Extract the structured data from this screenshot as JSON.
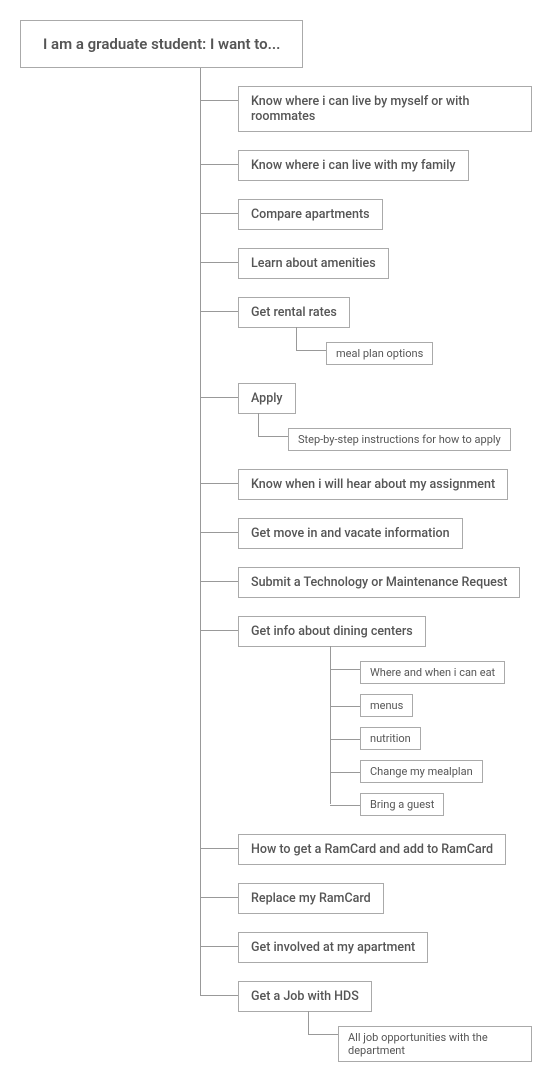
{
  "root": "I am a graduate student: I want to...",
  "nodes": [
    {
      "label": "Know where i can live by myself or with roommates",
      "children": []
    },
    {
      "label": "Know where i can live with my family",
      "children": []
    },
    {
      "label": "Compare apartments",
      "children": []
    },
    {
      "label": "Learn about amenities",
      "children": []
    },
    {
      "label": "Get rental rates",
      "children": [
        "meal plan options"
      ]
    },
    {
      "label": "Apply",
      "children": [
        "Step-by-step instructions for how to apply"
      ]
    },
    {
      "label": "Know when i will hear about my assignment",
      "children": []
    },
    {
      "label": "Get move in and vacate information",
      "children": []
    },
    {
      "label": "Submit a Technology or Maintenance Request",
      "children": []
    },
    {
      "label": "Get info about dining centers",
      "children": [
        "Where and when i can eat",
        "menus",
        "nutrition",
        "Change my mealplan",
        "Bring a guest"
      ]
    },
    {
      "label": "How to get a RamCard and add to RamCard",
      "children": []
    },
    {
      "label": "Replace my RamCard",
      "children": []
    },
    {
      "label": "Get involved at my apartment",
      "children": []
    },
    {
      "label": "Get a Job with HDS",
      "children": [
        "All job opportunities with the department"
      ]
    }
  ]
}
